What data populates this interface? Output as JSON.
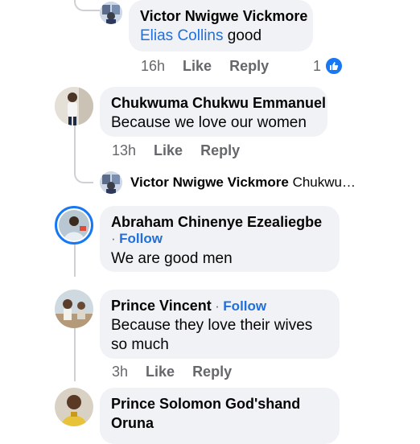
{
  "comments": [
    {
      "author": "Victor Nwigwe Vickmore",
      "mention": "Elias Collins",
      "text": "good",
      "time": "16h",
      "like": "Like",
      "reply": "Reply",
      "reaction_count": "1"
    },
    {
      "author": "Chukwuma Chukwu Emmanuel",
      "text": "Because we love our women",
      "time": "13h",
      "like": "Like",
      "reply": "Reply"
    },
    {
      "author": "Victor Nwigwe Vickmore",
      "preview": "Chukwu…"
    },
    {
      "author": "Abraham Chinenye Ezealiegbe",
      "separator": "·",
      "follow": "Follow",
      "text": "We are good men"
    },
    {
      "author": "Prince Vincent",
      "separator": "·",
      "follow": "Follow",
      "text_line1": "Because they love their wives",
      "text_line2": "so much",
      "time": "3h",
      "like": "Like",
      "reply": "Reply"
    },
    {
      "author_line1": "Prince Solomon God'shand",
      "author_line2": "Oruna"
    }
  ],
  "colors": {
    "link": "#216fdb",
    "bubble": "#f0f2f5",
    "meta": "#65676b",
    "like_blue": "#1877f2"
  }
}
